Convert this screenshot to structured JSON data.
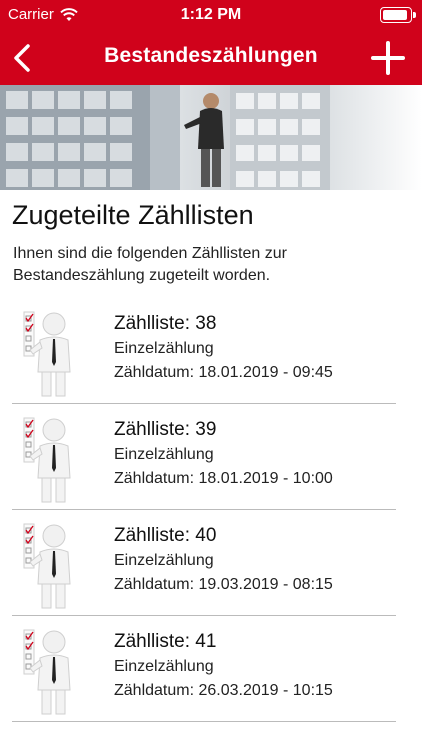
{
  "status_bar": {
    "carrier": "Carrier",
    "time": "1:12 PM"
  },
  "nav": {
    "title": "Bestandeszählungen"
  },
  "content": {
    "title": "Zugeteilte Zähllisten",
    "description": "Ihnen sind die folgenden Zähllisten zur Bestandeszählung zugeteilt worden."
  },
  "items": [
    {
      "title": "Zählliste: 38",
      "type": "Einzelzählung",
      "date": "Zähldatum: 18.01.2019 - 09:45"
    },
    {
      "title": "Zählliste: 39",
      "type": "Einzelzählung",
      "date": "Zähldatum: 18.01.2019 - 10:00"
    },
    {
      "title": "Zählliste: 40",
      "type": "Einzelzählung",
      "date": "Zähldatum: 19.03.2019 - 08:15"
    },
    {
      "title": "Zählliste: 41",
      "type": "Einzelzählung",
      "date": "Zähldatum: 26.03.2019 - 10:15"
    }
  ],
  "colors": {
    "accent": "#d0021b",
    "separator": "#bbbbbb"
  },
  "icons": [
    "wifi-icon",
    "battery-icon",
    "back-chevron-icon",
    "plus-icon",
    "checklist-person-icon"
  ]
}
